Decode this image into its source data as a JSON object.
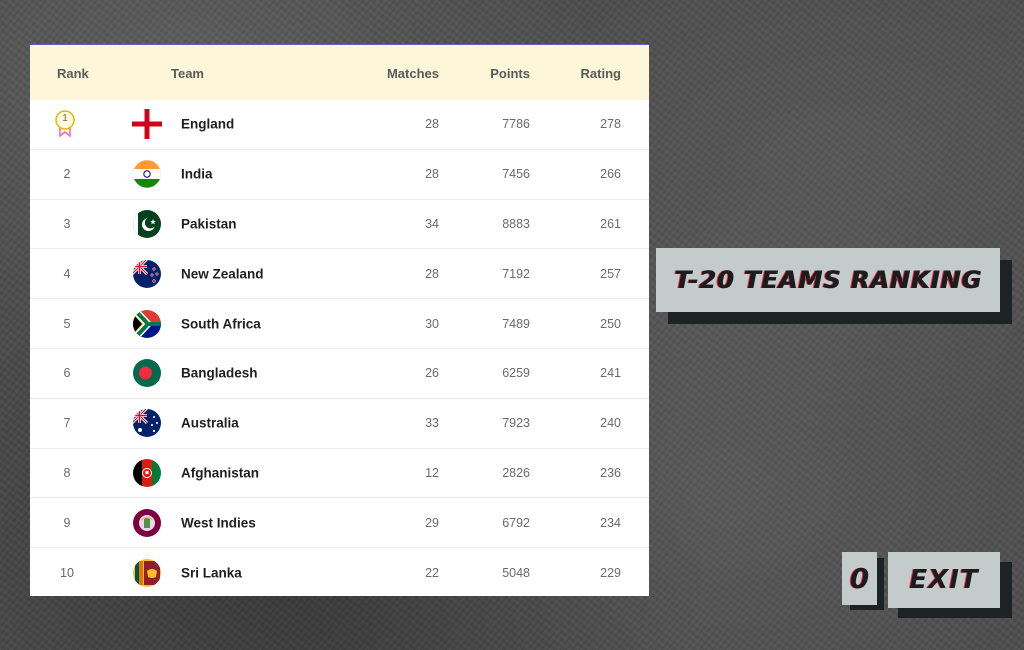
{
  "table": {
    "headers": {
      "rank": "Rank",
      "team": "Team",
      "matches": "Matches",
      "points": "Points",
      "rating": "Rating"
    },
    "rows": [
      {
        "rank": "1",
        "team": "England",
        "matches": "28",
        "points": "7786",
        "rating": "278",
        "flag_icon": "england-flag-icon",
        "medal_icon": "medal-icon"
      },
      {
        "rank": "2",
        "team": "India",
        "matches": "28",
        "points": "7456",
        "rating": "266",
        "flag_icon": "india-flag-icon"
      },
      {
        "rank": "3",
        "team": "Pakistan",
        "matches": "34",
        "points": "8883",
        "rating": "261",
        "flag_icon": "pakistan-flag-icon"
      },
      {
        "rank": "4",
        "team": "New Zealand",
        "matches": "28",
        "points": "7192",
        "rating": "257",
        "flag_icon": "new-zealand-flag-icon"
      },
      {
        "rank": "5",
        "team": "South Africa",
        "matches": "30",
        "points": "7489",
        "rating": "250",
        "flag_icon": "south-africa-flag-icon"
      },
      {
        "rank": "6",
        "team": "Bangladesh",
        "matches": "26",
        "points": "6259",
        "rating": "241",
        "flag_icon": "bangladesh-flag-icon"
      },
      {
        "rank": "7",
        "team": "Australia",
        "matches": "33",
        "points": "7923",
        "rating": "240",
        "flag_icon": "australia-flag-icon"
      },
      {
        "rank": "8",
        "team": "Afghanistan",
        "matches": "12",
        "points": "2826",
        "rating": "236",
        "flag_icon": "afghanistan-flag-icon"
      },
      {
        "rank": "9",
        "team": "West Indies",
        "matches": "29",
        "points": "6792",
        "rating": "234",
        "flag_icon": "west-indies-flag-icon"
      },
      {
        "rank": "10",
        "team": "Sri Lanka",
        "matches": "22",
        "points": "5048",
        "rating": "229",
        "flag_icon": "sri-lanka-flag-icon"
      }
    ]
  },
  "title_banner": {
    "text": "T-20 TEAMS RANKING"
  },
  "score": {
    "value": "0"
  },
  "exit_button": {
    "label": "EXIT"
  },
  "colors": {
    "header_bg": "#fdf6d8",
    "panel_bg": "#c4cccb",
    "panel_shadow": "#1d2224",
    "text_accent": "#ff2b4f",
    "background": "#4a4a4a"
  }
}
